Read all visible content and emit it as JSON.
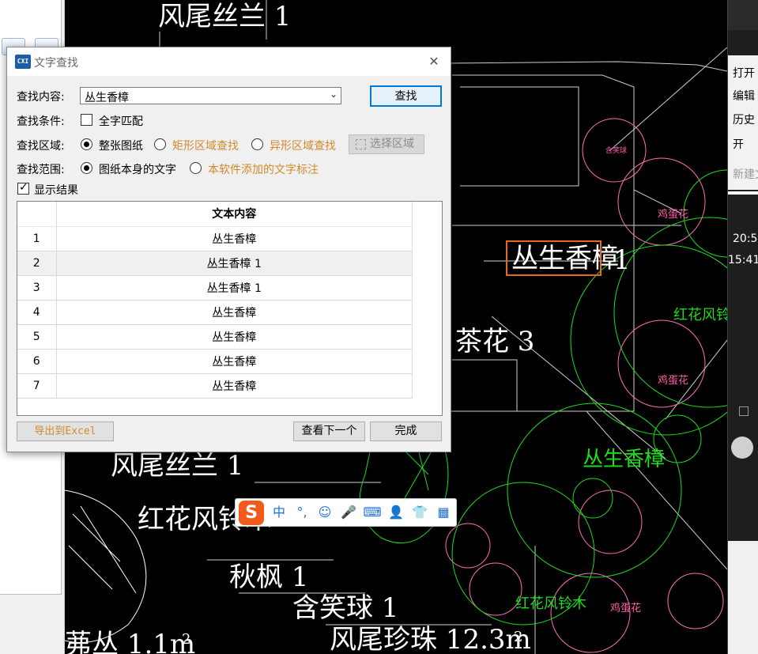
{
  "dialog": {
    "title": "文字查找",
    "app_icon_text": "CXI",
    "close_glyph": "✕",
    "find_content_label": "查找内容:",
    "find_content_value": "丛生香樟",
    "find_button": "查找",
    "condition_label": "查找条件:",
    "whole_word_label": "全字匹配",
    "whole_word_checked": false,
    "region_label": "查找区域:",
    "region_options": [
      "整张图纸",
      "矩形区域查找",
      "异形区域查找"
    ],
    "region_selected": 0,
    "select_area_button": "选择区域",
    "scope_label": "查找范围:",
    "scope_options": [
      "图纸本身的文字",
      "本软件添加的文字标注"
    ],
    "scope_selected": 0,
    "show_results_label": "显示结果",
    "show_results_checked": true,
    "table": {
      "header": "文本内容",
      "rows": [
        {
          "index": "1",
          "text": "丛生香樟"
        },
        {
          "index": "2",
          "text": "丛生香樟 1"
        },
        {
          "index": "3",
          "text": "丛生香樟 1"
        },
        {
          "index": "4",
          "text": "丛生香樟"
        },
        {
          "index": "5",
          "text": "丛生香樟"
        },
        {
          "index": "6",
          "text": "丛生香樟"
        },
        {
          "index": "7",
          "text": "丛生香樟"
        }
      ],
      "selected_row": 1
    },
    "export_button": "导出到Excel",
    "next_button": "查看下一个",
    "done_button": "完成"
  },
  "cad": {
    "labels_white": [
      "风尾丝兰 1",
      "丛生香樟",
      "1",
      "茶花 3",
      "风尾丝兰 1",
      "红花风铃木",
      "秋枫 1",
      "含笑球 1",
      "风尾珍珠 12.3m",
      "2",
      "茀丛 1.1m",
      "2"
    ],
    "labels_green": [
      "丛生香樟",
      "红花风铃木",
      "红花风铃木"
    ],
    "labels_pink": [
      "鸡蛋花",
      "鸡蛋花",
      "鸡蛋花",
      "含笑球"
    ],
    "highlight_color": "#e8671a"
  },
  "right_panel": {
    "items": [
      "打开",
      "编辑",
      "历史",
      "开",
      "新建文"
    ],
    "times": [
      "20:5",
      "15:41"
    ]
  },
  "ime": {
    "logo": "S",
    "items": [
      "中",
      "°,",
      "☺",
      "🎤",
      "⌨",
      "👤",
      "👕",
      "▦"
    ]
  }
}
